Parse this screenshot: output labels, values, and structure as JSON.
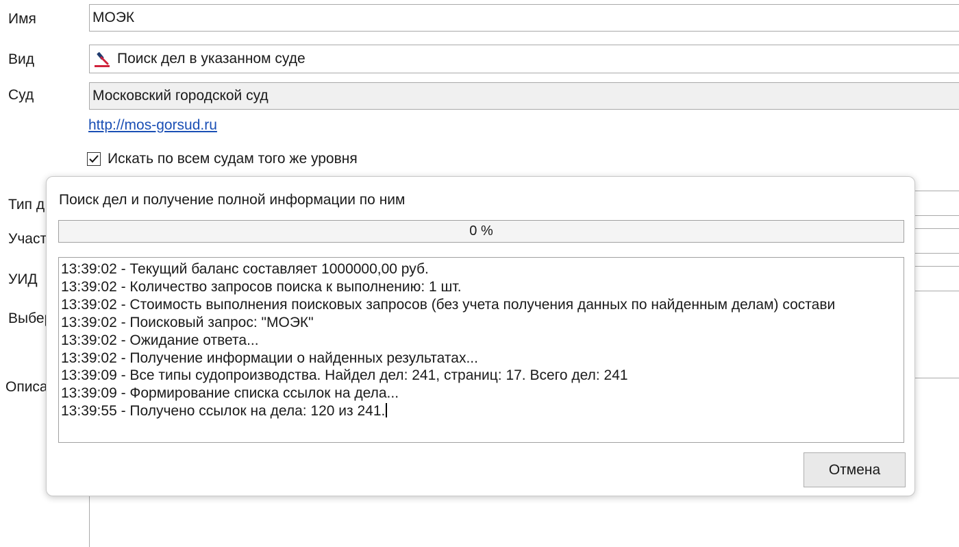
{
  "form": {
    "name_label": "Имя",
    "name_value": "МОЭК",
    "kind_label": "Вид",
    "kind_value": "Поиск дел в указанном суде",
    "court_label": "Суд",
    "court_value": "Московский городской суд",
    "court_link": "http://mos-gorsud.ru",
    "same_level_checkbox_label": "Искать по всем судам того же уровня",
    "same_level_checked": true,
    "partial_labels": {
      "type": "Тип д",
      "participant": "Участ",
      "uid": "УИД",
      "select": "Выбер",
      "description": "Описа"
    }
  },
  "dialog": {
    "title": "Поиск дел и получение полной информации по ним",
    "progress_percent": 0,
    "progress_text": "0 %",
    "log_lines": [
      "13:39:02 - Текущий баланс составляет 1000000,00 руб.",
      "13:39:02 - Количество запросов поиска к выполнению: 1 шт.",
      "13:39:02 - Стоимость выполнения поисковых запросов (без учета получения данных по найденным делам) состави",
      "13:39:02 - Поисковый запрос: \"МОЭК\"",
      "13:39:02 - Ожидание ответа...",
      "13:39:02 - Получение информации о найденных результатах...",
      "13:39:09 - Все типы судопроизводства. Найдел дел: 241, страниц: 17. Всего дел: 241",
      "13:39:09 - Формирование списка ссылок на дела...",
      "13:39:55 - Получено ссылок на дела:  120 из 241."
    ],
    "cancel_label": "Отмена"
  },
  "colors": {
    "link": "#1a4fb5",
    "icon_red": "#d0223b",
    "icon_navy": "#1f3b6e"
  }
}
